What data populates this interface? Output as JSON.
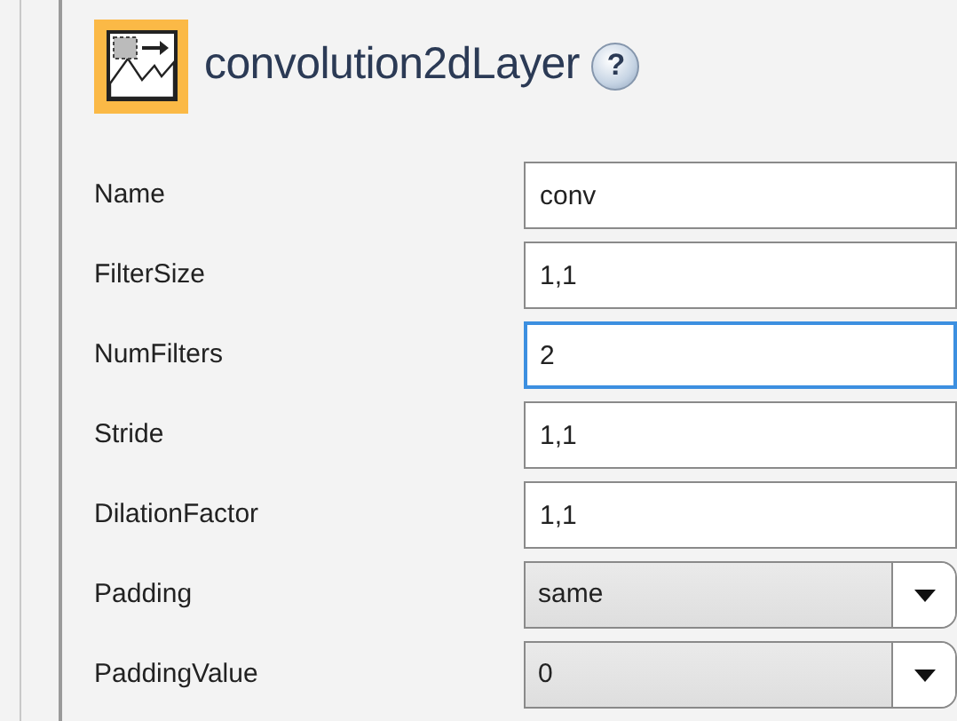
{
  "header": {
    "title": "convolution2dLayer",
    "help": "?"
  },
  "properties": [
    {
      "label": "Name",
      "kind": "text",
      "value": "conv",
      "focused": false
    },
    {
      "label": "FilterSize",
      "kind": "text",
      "value": "1,1",
      "focused": false
    },
    {
      "label": "NumFilters",
      "kind": "text",
      "value": "2",
      "focused": true
    },
    {
      "label": "Stride",
      "kind": "text",
      "value": "1,1",
      "focused": false
    },
    {
      "label": "DilationFactor",
      "kind": "text",
      "value": "1,1",
      "focused": false
    },
    {
      "label": "Padding",
      "kind": "dropdown",
      "value": "same"
    },
    {
      "label": "PaddingValue",
      "kind": "dropdown",
      "value": "0"
    }
  ]
}
